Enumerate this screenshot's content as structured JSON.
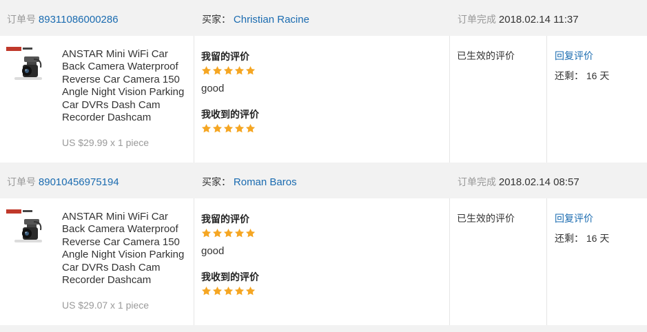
{
  "orders": [
    {
      "id_label": "订单号",
      "id": "89311086000286",
      "buyer_label": "买家：",
      "buyer": "Christian Racine",
      "status_label": "订单完成",
      "datetime": "2018.02.14 11:37",
      "product_title": "ANSTAR Mini WiFi Car Back Camera Waterproof Reverse Car Camera 150 Angle Night Vision Parking Car DVRs Dash Cam Recorder Dashcam",
      "price": "US $29.99 x 1 piece",
      "my_review_heading": "我留的评价",
      "my_rating": 5,
      "my_review_text": "good",
      "received_heading": "我收到的评价",
      "received_rating": 5,
      "eval_status": "已生效的评价",
      "reply_label": "回复评价",
      "remaining": "还剩： 16 天"
    },
    {
      "id_label": "订单号",
      "id": "89010456975194",
      "buyer_label": "买家：",
      "buyer": "Roman Baros",
      "status_label": "订单完成",
      "datetime": "2018.02.14 08:57",
      "product_title": "ANSTAR Mini WiFi Car Back Camera Waterproof Reverse Car Camera 150 Angle Night Vision Parking Car DVRs Dash Cam Recorder Dashcam",
      "price": "US $29.07 x 1 piece",
      "my_review_heading": "我留的评价",
      "my_rating": 5,
      "my_review_text": "good",
      "received_heading": "我收到的评价",
      "received_rating": 5,
      "eval_status": "已生效的评价",
      "reply_label": "回复评价",
      "remaining": "还剩： 16 天"
    }
  ],
  "colors": {
    "link": "#1a6bb0",
    "star": "#f5a623",
    "header_bg": "#f2f2f2"
  },
  "icons": {
    "star": "star-icon",
    "product": "dashcam-product-image"
  }
}
